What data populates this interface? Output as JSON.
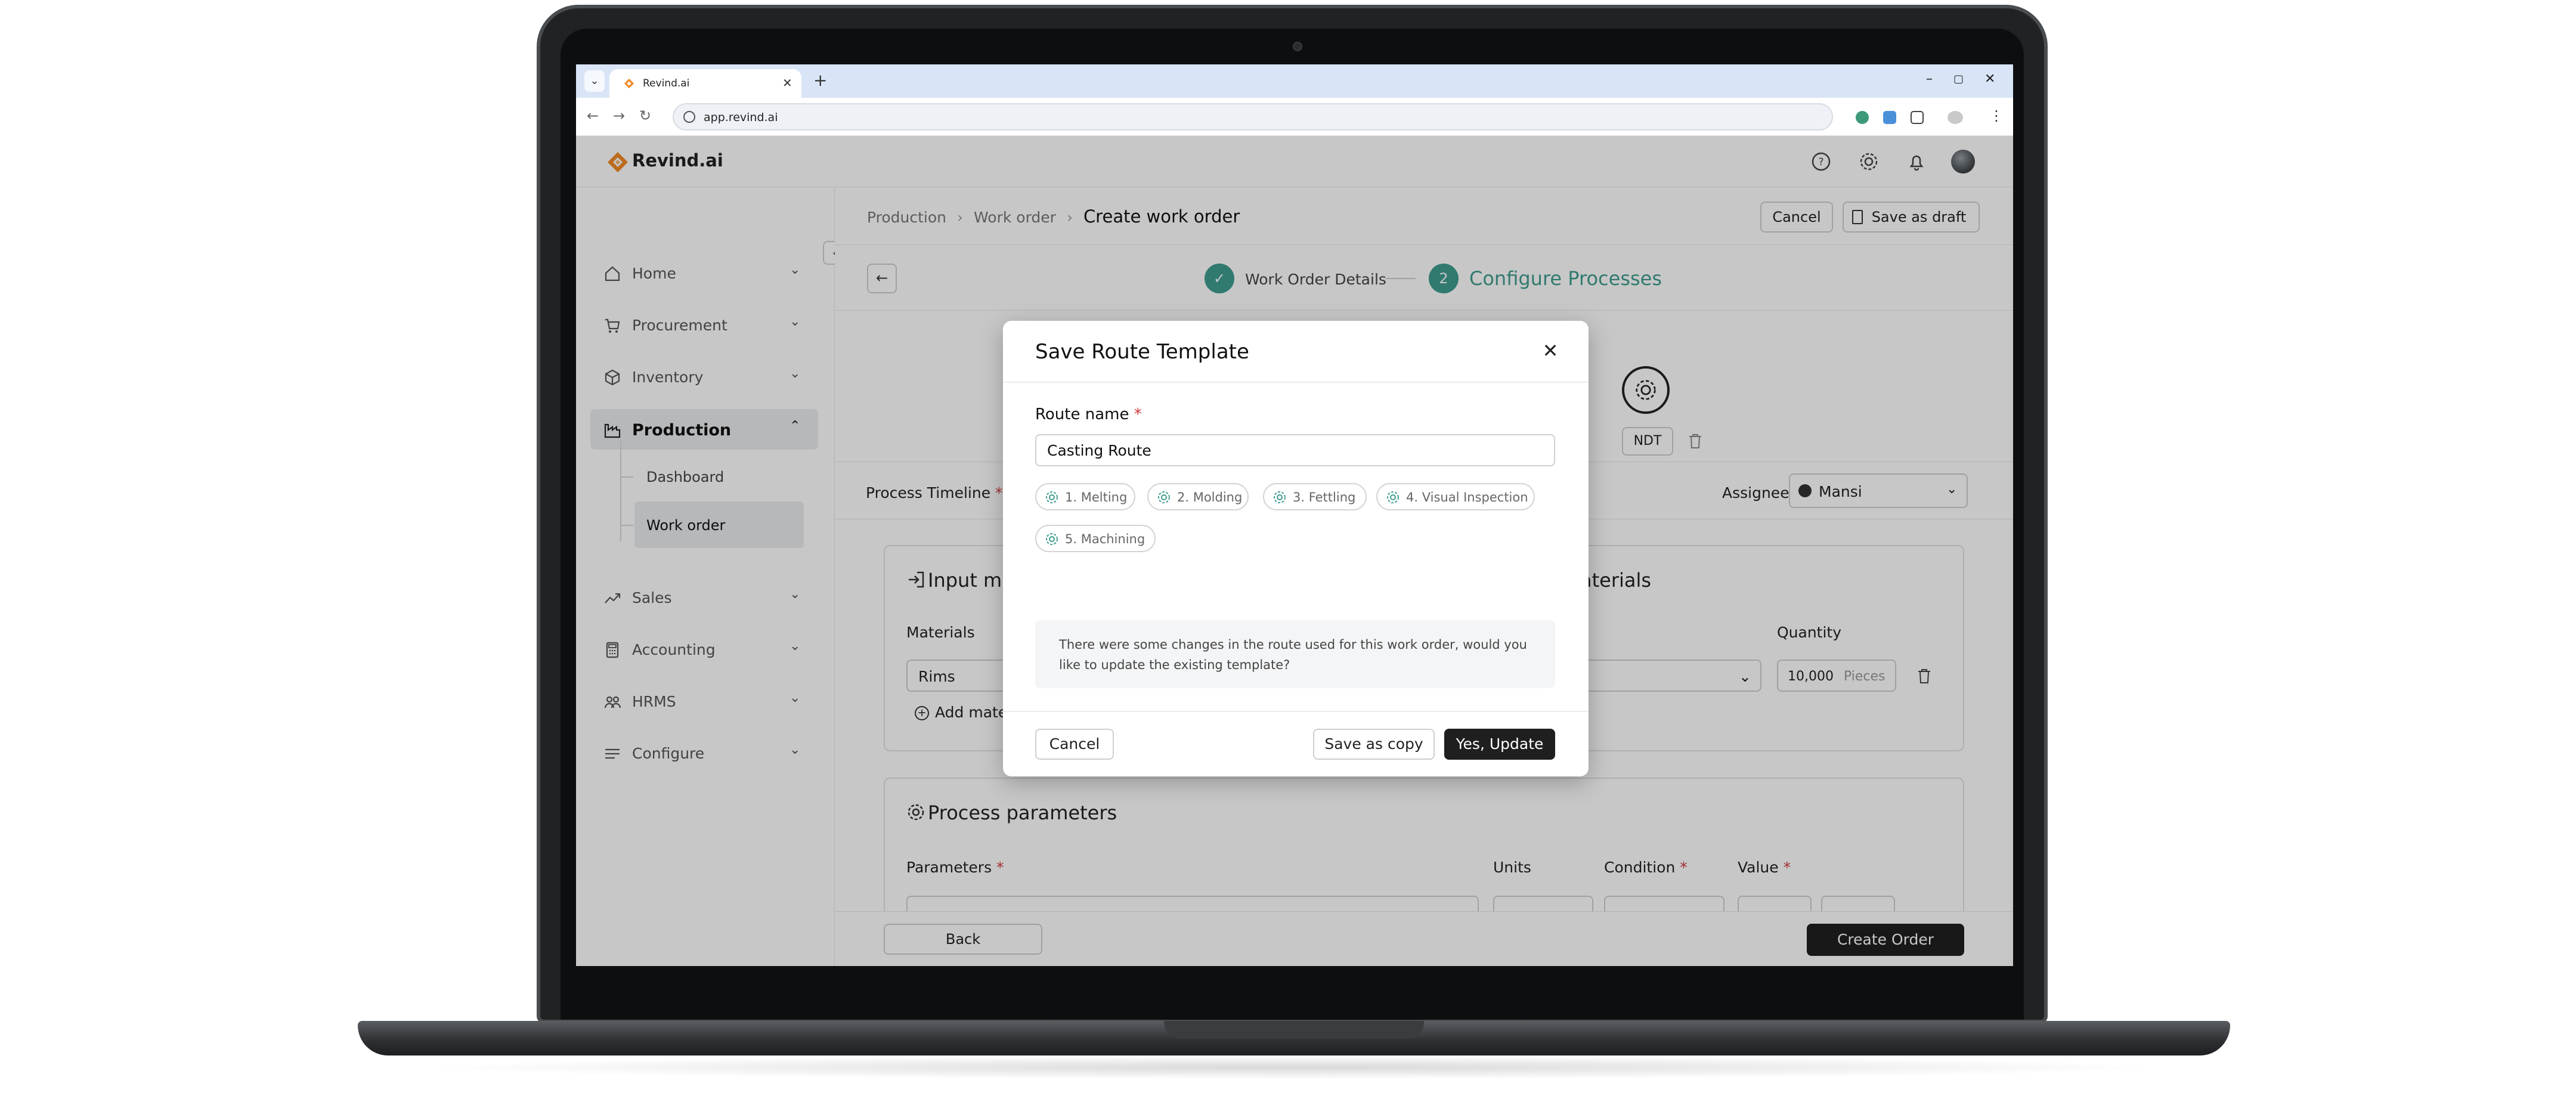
{
  "browser": {
    "tab_title": "Revind.ai",
    "tab_dropdown_icon": "chevron-down-icon",
    "new_tab": "+",
    "url": "app.revind.ai",
    "window_controls": [
      "–",
      "▢",
      "✕"
    ]
  },
  "app": {
    "brand": "Revind.ai",
    "brand_color": "#f08a24",
    "accent_color": "#3f9d8f"
  },
  "header": {
    "icons": [
      "help-icon",
      "settings-icon",
      "bell-icon",
      "avatar"
    ]
  },
  "sidebar": {
    "items": [
      {
        "label": "Home",
        "icon": "home-icon"
      },
      {
        "label": "Procurement",
        "icon": "cart-icon"
      },
      {
        "label": "Inventory",
        "icon": "box-icon"
      },
      {
        "label": "Production",
        "icon": "factory-icon"
      },
      {
        "label": "Sales",
        "icon": "trend-icon"
      },
      {
        "label": "Accounting",
        "icon": "calculator-icon"
      },
      {
        "label": "HRMS",
        "icon": "people-icon"
      },
      {
        "label": "Configure",
        "icon": "sliders-icon"
      }
    ],
    "production_sub": [
      "Dashboard",
      "Work order"
    ]
  },
  "main": {
    "breadcrumb": [
      "Production",
      "Work order",
      "Create work order"
    ],
    "cancel": "Cancel",
    "save_draft": "Save as draft",
    "steps": {
      "step1_label": "Work Order Details",
      "step2_number": "2",
      "step2_label": "Configure Processes"
    },
    "ndt": "NDT",
    "process_timeline": "Process Timeline",
    "assignee_label": "Assignee",
    "assignee_value": "Mansi",
    "input_card_title": "Input m",
    "output_card_title": "aterials",
    "materials_label": "Materials",
    "material_value": "Rims",
    "quantity_label": "Quantity",
    "quantity_value": "10,000",
    "quantity_unit": "Pieces",
    "add_material": "Add mate",
    "params_title": "Process parameters",
    "params_headers": {
      "parameters": "Parameters",
      "units": "Units",
      "condition": "Condition",
      "value": "Value"
    },
    "back": "Back",
    "create_order": "Create Order"
  },
  "modal": {
    "title": "Save Route Template",
    "route_label": "Route name",
    "route_value": "Casting Route",
    "processes": [
      "1. Melting",
      "2. Molding",
      "3. Fettling",
      "4. Visual Inspection",
      "5. Machining"
    ],
    "notice": "There were some changes in the route used for this work order, would you like to update the existing template?",
    "cancel": "Cancel",
    "save_copy": "Save as copy",
    "confirm": "Yes, Update"
  }
}
